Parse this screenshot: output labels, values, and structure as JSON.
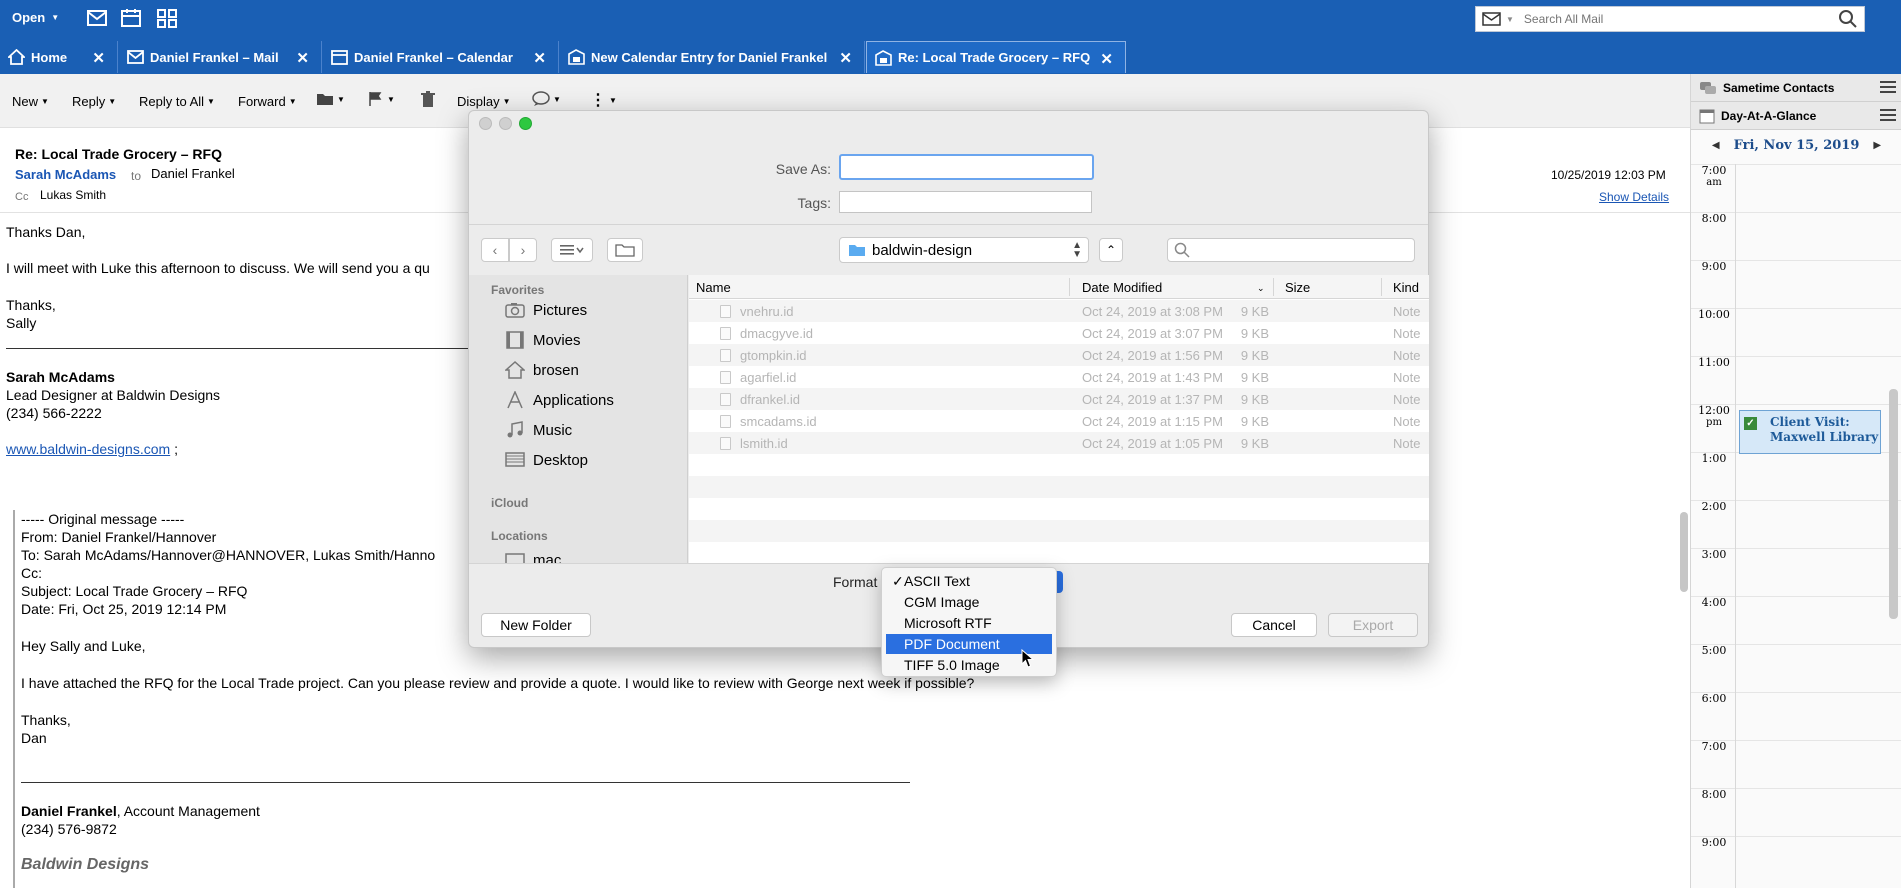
{
  "topbar": {
    "open_label": "Open",
    "search_placeholder": "Search All Mail"
  },
  "tabs": [
    {
      "label": "Home"
    },
    {
      "label": "Daniel Frankel – Mail"
    },
    {
      "label": "Daniel Frankel – Calendar"
    },
    {
      "label": "New Calendar Entry for Daniel Frankel"
    },
    {
      "label": "Re: Local Trade Grocery – RFQ"
    }
  ],
  "toolbar": {
    "new": "New",
    "reply": "Reply",
    "reply_all": "Reply to All",
    "forward": "Forward",
    "display": "Display"
  },
  "mail": {
    "subject": "Re: Local Trade Grocery – RFQ",
    "from": "Sarah McAdams",
    "to_word": "to",
    "to": "Daniel Frankel",
    "cc_word": "Cc",
    "cc": "Lukas Smith",
    "date": "10/25/2019 12:03 PM",
    "show_details": "Show Details",
    "greeting": "Thanks Dan,",
    "line1": "I will meet with Luke this afternoon to discuss. We will send you a qu",
    "thanks": "Thanks,",
    "sign": "Sally",
    "sig_name": "Sarah McAdams",
    "sig_title": "Lead Designer at Baldwin Designs",
    "sig_phone": "(234) 566-2222",
    "sig_web": "www.baldwin-designs.com",
    "sig_web_suffix": " ;",
    "orig_header": "----- Original message -----",
    "orig_from": "From: Daniel Frankel/Hannover",
    "orig_to": "To: Sarah McAdams/Hannover@HANNOVER, Lukas Smith/Hanno",
    "orig_cc": "Cc:",
    "orig_subject": "Subject: Local Trade Grocery – RFQ",
    "orig_date": "Date: Fri, Oct 25, 2019 12:14 PM",
    "orig_greet": "Hey Sally and Luke,",
    "orig_body": "I have attached the RFQ for the Local Trade project. Can you please review and provide a quote. I would like to review with George next week if possible?",
    "orig_thanks": "Thanks,",
    "orig_sign": "Dan",
    "orig_sig_name": "Daniel Frankel",
    "orig_sig_title": ", Account Management",
    "orig_sig_phone": "(234) 576-9872",
    "orig_company": "Baldwin Designs"
  },
  "rightpane": {
    "sametime": "Sametime Contacts",
    "day_at_a_glance": "Day-At-A-Glance",
    "date": "Fri, Nov 15, 2019",
    "hours": [
      {
        "time": "7:00",
        "ampm": "am"
      },
      {
        "time": "8:00",
        "ampm": ""
      },
      {
        "time": "9:00",
        "ampm": ""
      },
      {
        "time": "10:00",
        "ampm": ""
      },
      {
        "time": "11:00",
        "ampm": ""
      },
      {
        "time": "12:00",
        "ampm": "pm"
      },
      {
        "time": "1:00",
        "ampm": ""
      },
      {
        "time": "2:00",
        "ampm": ""
      },
      {
        "time": "3:00",
        "ampm": ""
      },
      {
        "time": "4:00",
        "ampm": ""
      },
      {
        "time": "5:00",
        "ampm": ""
      },
      {
        "time": "6:00",
        "ampm": ""
      },
      {
        "time": "7:00",
        "ampm": ""
      },
      {
        "time": "8:00",
        "ampm": ""
      },
      {
        "time": "9:00",
        "ampm": ""
      }
    ],
    "event_line1": "Client Visit:",
    "event_line2": "Maxwell Library"
  },
  "dialog": {
    "save_as_label": "Save As:",
    "save_as_value": "",
    "tags_label": "Tags:",
    "folder": "baldwin-design",
    "sidebar": {
      "favorites": "Favorites",
      "items": [
        "Pictures",
        "Movies",
        "brosen",
        "Applications",
        "Music",
        "Desktop"
      ],
      "icloud": "iCloud",
      "locations": "Locations",
      "loc_item": "mac"
    },
    "columns": {
      "name": "Name",
      "date": "Date Modified",
      "size": "Size",
      "kind": "Kind"
    },
    "files": [
      {
        "name": "vnehru.id",
        "date": "Oct 24, 2019 at 3:08 PM",
        "size": "9 KB",
        "kind": "Note"
      },
      {
        "name": "dmacgyve.id",
        "date": "Oct 24, 2019 at 3:07 PM",
        "size": "9 KB",
        "kind": "Note"
      },
      {
        "name": "gtompkin.id",
        "date": "Oct 24, 2019 at 1:56 PM",
        "size": "9 KB",
        "kind": "Note"
      },
      {
        "name": "agarfiel.id",
        "date": "Oct 24, 2019 at 1:43 PM",
        "size": "9 KB",
        "kind": "Note"
      },
      {
        "name": "dfrankel.id",
        "date": "Oct 24, 2019 at 1:37 PM",
        "size": "9 KB",
        "kind": "Note"
      },
      {
        "name": "smcadams.id",
        "date": "Oct 24, 2019 at 1:15 PM",
        "size": "9 KB",
        "kind": "Note"
      },
      {
        "name": "lsmith.id",
        "date": "Oct 24, 2019 at 1:05 PM",
        "size": "9 KB",
        "kind": "Note"
      }
    ],
    "format_label": "Format",
    "format_options": [
      "ASCII Text",
      "CGM Image",
      "Microsoft RTF",
      "PDF Document",
      "TIFF 5.0 Image"
    ],
    "format_checked": "ASCII Text",
    "format_highlighted": "PDF Document",
    "new_folder": "New Folder",
    "cancel": "Cancel",
    "export": "Export"
  },
  "colors": {
    "brand_blue": "#1a5fb4",
    "accent": "#2a6fe0",
    "link": "#1a56b4"
  }
}
